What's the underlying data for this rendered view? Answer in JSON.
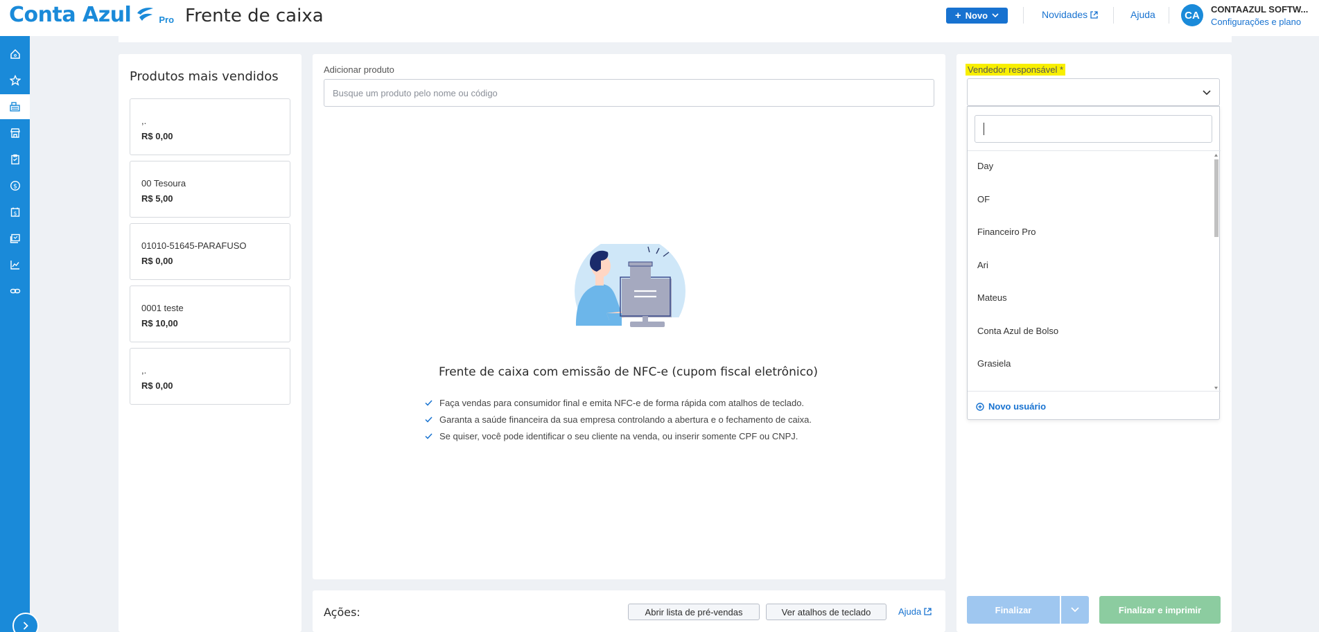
{
  "header": {
    "logo_text": "Conta Azul",
    "logo_plan": "Pro",
    "page_title": "Frente de caixa",
    "new_button_label": "Novo",
    "news_link": "Novidades",
    "help_link": "Ajuda",
    "avatar_initials": "CA",
    "company_name": "CONTAAZUL SOFTW...",
    "company_sub": "Configurações e plano"
  },
  "sidebar": {
    "items": [
      "home-icon",
      "star-icon",
      "cash-register-icon",
      "store-icon",
      "clipboard-icon",
      "dollar-icon",
      "calendar-dollar-icon",
      "receipt-icon",
      "chart-line-icon",
      "link-icon"
    ],
    "active_index": 2
  },
  "products": {
    "title": "Produtos mais vendidos",
    "items": [
      {
        "name": ",.",
        "price": "R$ 0,00"
      },
      {
        "name": "00 Tesoura",
        "price": "R$ 5,00"
      },
      {
        "name": "01010-51645-PARAFUSO",
        "price": "R$ 0,00"
      },
      {
        "name": "0001 teste",
        "price": "R$ 10,00"
      },
      {
        "name": ",.",
        "price": "R$ 0,00"
      }
    ]
  },
  "main": {
    "add_product_label": "Adicionar produto",
    "add_product_placeholder": "Busque um produto pelo nome ou código",
    "empty_title": "Frente de caixa com emissão de NFC-e (cupom fiscal eletrônico)",
    "bullets": [
      "Faça vendas para consumidor final e emita NFC-e de forma rápida com atalhos de teclado.",
      "Garanta a saúde financeira da sua empresa controlando a abertura e o fechamento de caixa.",
      "Se quiser, você pode identificar o seu cliente na venda, ou inserir somente CPF ou CNPJ."
    ]
  },
  "actions": {
    "label": "Ações:",
    "open_presales": "Abrir lista de pré-vendas",
    "shortcuts": "Ver atalhos de teclado",
    "help": "Ajuda"
  },
  "seller": {
    "label": "Vendedor responsável *",
    "search_value": "",
    "options": [
      "Day",
      "OF",
      "Financeiro Pro",
      "Ari",
      "Mateus",
      "Conta Azul de Bolso",
      "Grasiela"
    ],
    "new_user": "Novo usuário"
  },
  "footer_buttons": {
    "finalize": "Finalizar",
    "finalize_print": "Finalizar e imprimir"
  },
  "colors": {
    "brand": "#1a8ad9",
    "primary": "#1772d0",
    "highlight": "#f8ef00",
    "finalize": "#9fc7f0",
    "finalize_print": "#8ccca0"
  }
}
